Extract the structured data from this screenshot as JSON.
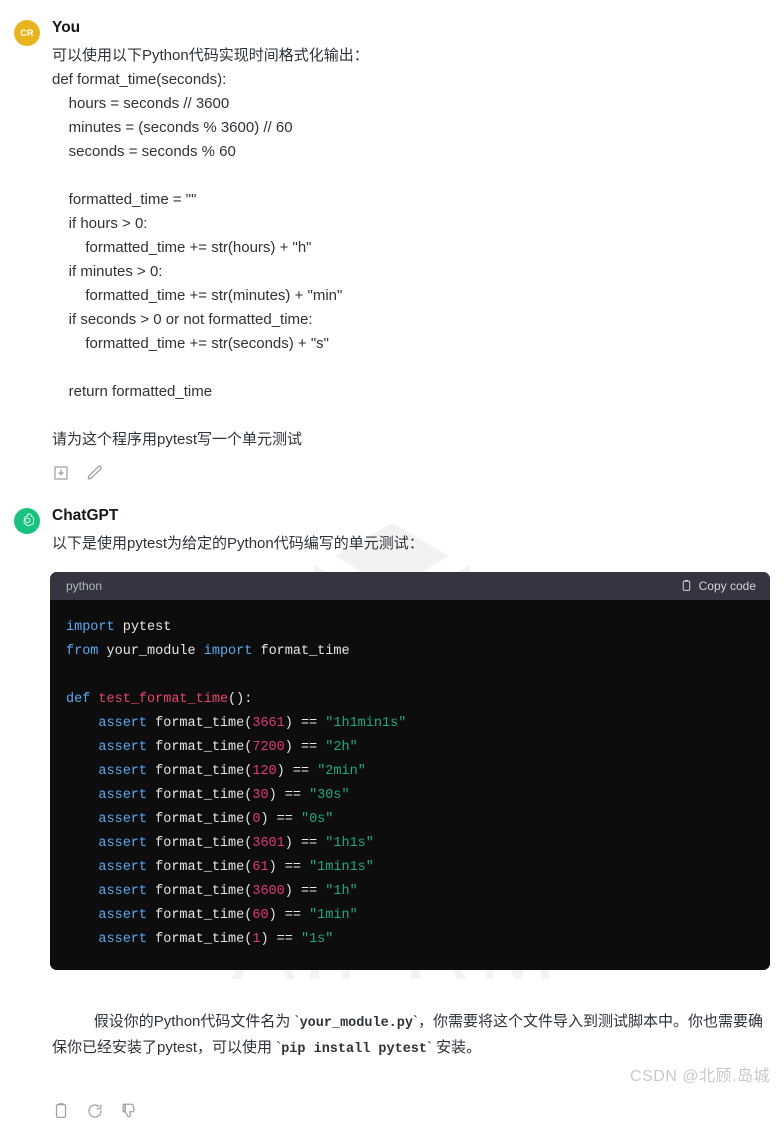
{
  "watermarks": {
    "aiprm": "AIPRM",
    "csdn": "CSDN @北顾.岛城"
  },
  "user_message": {
    "avatar_initials": "CR",
    "author": "You",
    "intro": "可以使用以下Python代码实现时间格式化输出：",
    "code_lines": [
      "def format_time(seconds):",
      "    hours = seconds // 3600",
      "    minutes = (seconds % 3600) // 60",
      "    seconds = seconds % 60",
      "",
      "    formatted_time = \"\"",
      "    if hours > 0:",
      "        formatted_time += str(hours) + \"h\"",
      "    if minutes > 0:",
      "        formatted_time += str(minutes) + \"min\"",
      "    if seconds > 0 or not formatted_time:",
      "        formatted_time += str(seconds) + \"s\"",
      "",
      "    return formatted_time"
    ],
    "request": "请为这个程序用pytest写一个单元测试",
    "actions": [
      {
        "name": "save-icon",
        "label": "Save"
      },
      {
        "name": "edit-icon",
        "label": "Edit"
      }
    ]
  },
  "assistant_message": {
    "author": "ChatGPT",
    "intro": "以下是使用pytest为给定的Python代码编写的单元测试：",
    "code_block": {
      "language": "python",
      "copy_label": "Copy code",
      "code": "import pytest\nfrom your_module import format_time\n\ndef test_format_time():\n    assert format_time(3661) == \"1h1min1s\"\n    assert format_time(7200) == \"2h\"\n    assert format_time(120) == \"2min\"\n    assert format_time(30) == \"30s\"\n    assert format_time(0) == \"0s\"\n    assert format_time(3601) == \"1h1s\"\n    assert format_time(61) == \"1min1s\"\n    assert format_time(3600) == \"1h\"\n    assert format_time(60) == \"1min\"\n    assert format_time(1) == \"1s\"",
      "assertions": [
        {
          "input": "3661",
          "expected": "1h1min1s"
        },
        {
          "input": "7200",
          "expected": "2h"
        },
        {
          "input": "120",
          "expected": "2min"
        },
        {
          "input": "30",
          "expected": "30s"
        },
        {
          "input": "0",
          "expected": "0s"
        },
        {
          "input": "3601",
          "expected": "1h1s"
        },
        {
          "input": "61",
          "expected": "1min1s"
        },
        {
          "input": "3600",
          "expected": "1h"
        },
        {
          "input": "60",
          "expected": "1min"
        },
        {
          "input": "1",
          "expected": "1s"
        }
      ]
    },
    "outro_part1": "假设你的Python代码文件名为 `",
    "outro_code1": "your_module.py",
    "outro_part2": "`，你需要将这个文件导入到测试脚本中。你也需要确保你已经安装了pytest，可以使用 `",
    "outro_code2": "pip install pytest",
    "outro_part3": "` 安装。",
    "actions": [
      {
        "name": "copy-icon",
        "label": "Copy"
      },
      {
        "name": "regenerate-icon",
        "label": "Regenerate"
      },
      {
        "name": "thumbs-down-icon",
        "label": "Bad response"
      }
    ]
  },
  "colors": {
    "user_avatar": "#e8b521",
    "bot_avatar": "#19c37d",
    "code_header": "#343541",
    "code_body": "#0d0d0d",
    "keyword": "#5ba9f2",
    "function": "#e8436f",
    "number": "#e0397b",
    "string": "#1fa97f"
  }
}
